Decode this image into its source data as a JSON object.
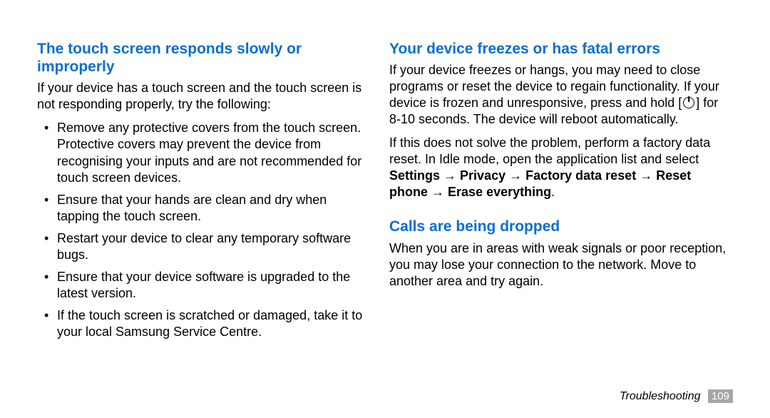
{
  "left": {
    "heading": "The touch screen responds slowly or improperly",
    "intro": "If your device has a touch screen and the touch screen is not responding properly, try the following:",
    "bullets": [
      "Remove any protective covers from the touch screen. Protective covers may prevent the device from recognising your inputs and are not recommended for touch screen devices.",
      "Ensure that your hands are clean and dry when tapping the touch screen.",
      "Restart your device to clear any temporary software bugs.",
      "Ensure that your device software is upgraded to the latest version.",
      "If the touch screen is scratched or damaged, take it to your local Samsung Service Centre."
    ]
  },
  "right": {
    "section1": {
      "heading": "Your device freezes or has fatal errors",
      "para1_pre": "If your device freezes or hangs, you may need to close programs or reset the device to regain functionality. If your device is frozen and unresponsive, press and hold [",
      "para1_post": "] for 8-10 seconds. The device will reboot automatically.",
      "para2_pre": "If this does not solve the problem, perform a factory data reset. In Idle mode, open the application list and select ",
      "bold_settings": "Settings",
      "bold_privacy": "Privacy",
      "bold_factory": "Factory data reset",
      "bold_reset": "Reset phone",
      "bold_erase": "Erase everything",
      "arrow": "→",
      "period": "."
    },
    "section2": {
      "heading": "Calls are being dropped",
      "para": "When you are in areas with weak signals or poor reception, you may lose your connection to the network. Move to another area and try again."
    }
  },
  "footer": {
    "section": "Troubleshooting",
    "page": "109"
  }
}
